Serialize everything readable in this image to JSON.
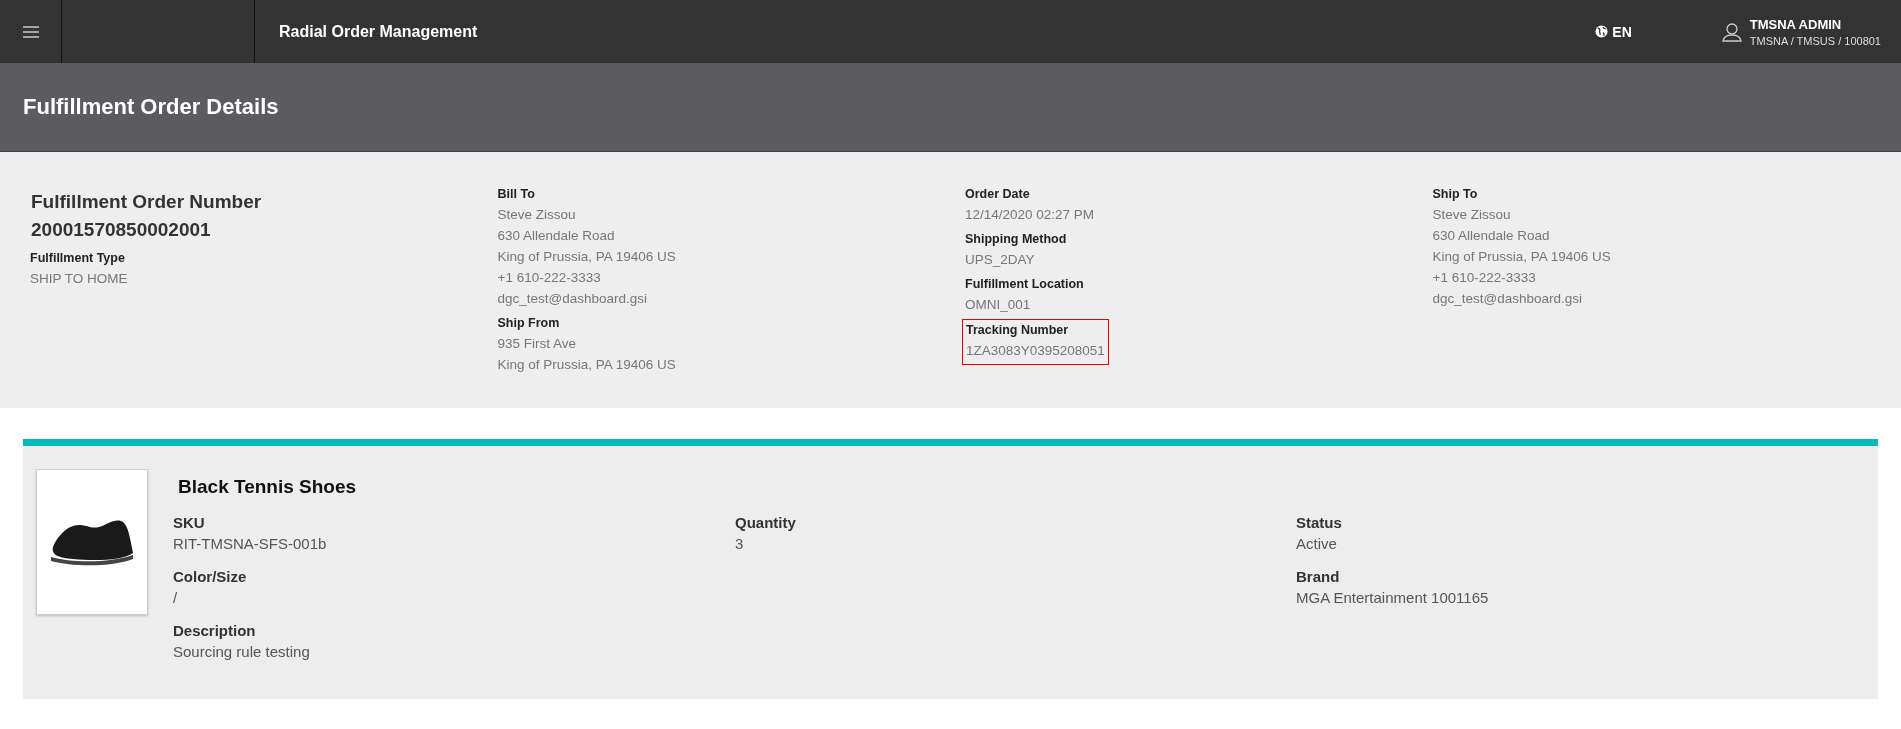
{
  "header": {
    "app_title": "Radial Order Management",
    "language": "EN",
    "user_name": "TMSNA ADMIN",
    "user_org": "TMSNA / TMSUS / 100801"
  },
  "page_title": "Fulfillment Order Details",
  "order": {
    "number_label": "Fulfillment Order Number",
    "number": "20001570850002001",
    "columns": [
      [
        {
          "label": "Fulfillment Type",
          "lines": [
            "SHIP TO HOME"
          ],
          "highlighted": false
        }
      ],
      [
        {
          "label": "Bill To",
          "lines": [
            "Steve Zissou",
            "630 Allendale Road",
            "King of Prussia, PA 19406 US",
            "+1 610-222-3333",
            "dgc_test@dashboard.gsi"
          ],
          "highlighted": false
        },
        {
          "label": "Ship From",
          "lines": [
            "935 First Ave",
            "King of Prussia, PA 19406 US"
          ],
          "highlighted": false
        }
      ],
      [
        {
          "label": "Order Date",
          "lines": [
            "12/14/2020 02:27 PM"
          ],
          "highlighted": false
        },
        {
          "label": "Shipping Method",
          "lines": [
            "UPS_2DAY"
          ],
          "highlighted": false
        },
        {
          "label": "Fulfillment Location",
          "lines": [
            "OMNI_001"
          ],
          "highlighted": false
        },
        {
          "label": "Tracking Number",
          "lines": [
            "1ZA3083Y0395208051"
          ],
          "highlighted": true
        }
      ],
      [
        {
          "label": "Ship To",
          "lines": [
            "Steve Zissou",
            "630 Allendale Road",
            "King of Prussia, PA 19406 US",
            "+1 610-222-3333",
            "dgc_test@dashboard.gsi"
          ],
          "highlighted": false
        }
      ]
    ]
  },
  "product": {
    "name": "Black Tennis Shoes",
    "columns": [
      [
        {
          "label": "SKU",
          "value": "RIT-TMSNA-SFS-001b"
        },
        {
          "label": "Color/Size",
          "value": "/"
        },
        {
          "label": "Description",
          "value": "Sourcing rule testing"
        }
      ],
      [
        {
          "label": "Quantity",
          "value": "3"
        }
      ],
      [
        {
          "label": "Status",
          "value": "Active"
        },
        {
          "label": "Brand",
          "value": "MGA Entertainment 1001165"
        }
      ]
    ]
  }
}
